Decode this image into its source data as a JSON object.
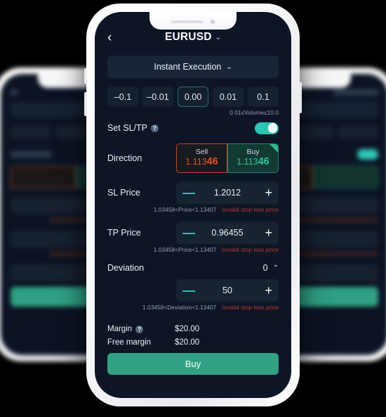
{
  "app": {
    "back_icon": "chevron-left-icon",
    "symbol": "EURUSD",
    "symbol_caret": "⌄",
    "execution_mode": "Instant Execution",
    "execution_caret": "⌄"
  },
  "volume": {
    "chips": [
      "–0.1",
      "–0.01",
      "0.00",
      "0.01",
      "0.1"
    ],
    "active_index": 2,
    "hint": "0.01≤Volume≤10.0"
  },
  "sltp": {
    "label": "Set SL/TP",
    "help_icon": "question-mark-icon",
    "help_glyph": "?",
    "enabled": true
  },
  "direction": {
    "label": "Direction",
    "sell": {
      "name": "Sell",
      "price_prefix": "1.113",
      "price_suffix": "46"
    },
    "buy": {
      "name": "Buy",
      "price_prefix": "1.113",
      "price_suffix": "46"
    },
    "selected": "buy"
  },
  "sl_price": {
    "label": "SL Price",
    "minus": "—",
    "value": "1.2012",
    "plus": "+",
    "range_hint": "1.03458<Price<1.13407",
    "error": "Invalid stop loss price"
  },
  "tp_price": {
    "label": "TP Price",
    "minus": "—",
    "value": "0.96455",
    "plus": "+",
    "range_hint": "1.03458<Price<1.13407",
    "error": "Invalid stop loss price"
  },
  "deviation": {
    "label": "Deviation",
    "header_value": "0",
    "caret": "⌃",
    "minus": "—",
    "value": "50",
    "plus": "+",
    "range_hint": "1.03458<Deviation<1.13407",
    "error": "Invalid stop loss price"
  },
  "margins": {
    "margin_label": "Margin",
    "margin_help_icon": "question-mark-icon",
    "margin_help_glyph": "?",
    "margin_value": "$20.00",
    "free_margin_label": "Free margin",
    "free_margin_value": "$20.00"
  },
  "cta": {
    "label": "Buy"
  },
  "colors": {
    "page_background": "#000000",
    "screen_background": "#0d1526",
    "accent_teal": "#2dc2b4",
    "buy_green": "#2fc39a",
    "sell_red": "#e24e28",
    "error_red": "#c0392b",
    "cta_green": "#32a183",
    "panel": "#172232"
  }
}
